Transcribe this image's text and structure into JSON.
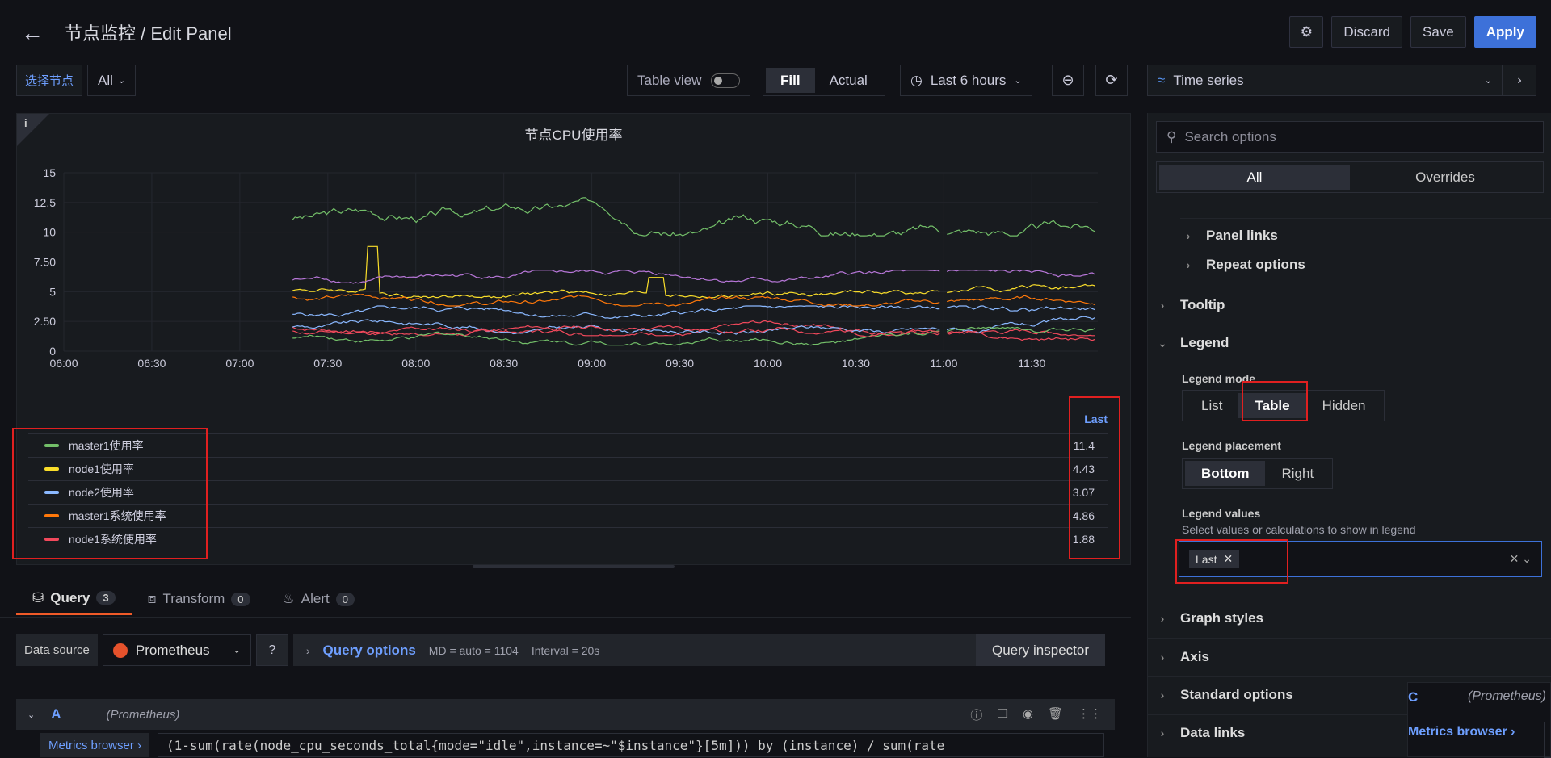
{
  "header": {
    "title": "节点监控 / Edit Panel",
    "discard": "Discard",
    "save": "Save",
    "apply": "Apply"
  },
  "vars": {
    "label": "选择节点",
    "value": "All"
  },
  "toolbar": {
    "table_view": "Table view",
    "fill": "Fill",
    "actual": "Actual",
    "time_range": "Last 6 hours"
  },
  "viz": {
    "name": "Time series"
  },
  "panel": {
    "title": "节点CPU使用率",
    "legend_header": "Last"
  },
  "chart_data": {
    "type": "line",
    "title": "节点CPU使用率",
    "x": [
      "06:00",
      "06:30",
      "07:00",
      "07:30",
      "08:00",
      "08:30",
      "09:00",
      "09:30",
      "10:00",
      "10:30",
      "11:00",
      "11:30"
    ],
    "yticks": [
      "0",
      "2.50",
      "5",
      "7.50",
      "10",
      "12.5",
      "15"
    ],
    "ylim": [
      0,
      15
    ],
    "data_start": "07:18",
    "data_end": "11:52",
    "series": [
      {
        "name": "master1使用率",
        "color": "#73bf69",
        "last": "11.4"
      },
      {
        "name": "node1使用率",
        "color": "#fade2a",
        "last": "4.43"
      },
      {
        "name": "node2使用率",
        "color": "#8ab8ff",
        "last": "3.07"
      },
      {
        "name": "master1系统使用率",
        "color": "#ff780a",
        "last": "4.86"
      },
      {
        "name": "node1系统使用率",
        "color": "#f2495c",
        "last": "1.88"
      }
    ],
    "legend": "bottom-table"
  },
  "query": {
    "tabs": [
      {
        "label": "Query",
        "count": "3"
      },
      {
        "label": "Transform",
        "count": "0"
      },
      {
        "label": "Alert",
        "count": "0"
      }
    ],
    "datasource_label": "Data source",
    "datasource": "Prometheus",
    "query_options": "Query options",
    "md": "MD = auto = 1104",
    "interval": "Interval = 20s",
    "inspector": "Query inspector",
    "ref": "A",
    "ref_source": "(Prometheus)",
    "metrics_browser": "Metrics browser ›",
    "expr": "(1-sum(rate(node_cpu_seconds_total{mode=\"idle\",instance=~\"$instance\"}[5m])) by (instance) / sum(rate"
  },
  "options": {
    "search_placeholder": "Search options",
    "tab_all": "All",
    "tab_overrides": "Overrides",
    "panel_links": "Panel links",
    "repeat_options": "Repeat options",
    "tooltip": "Tooltip",
    "legend": "Legend",
    "legend_mode_label": "Legend mode",
    "legend_modes": [
      "List",
      "Table",
      "Hidden"
    ],
    "legend_placement_label": "Legend placement",
    "legend_placements": [
      "Bottom",
      "Right"
    ],
    "legend_values_label": "Legend values",
    "legend_values_desc": "Select values or calculations to show in legend",
    "legend_values_chip": "Last",
    "graph_styles": "Graph styles",
    "axis": "Axis",
    "standard_options": "Standard options",
    "data_links": "Data links",
    "floating_ref": "C",
    "floating_src": "(Prometheus)",
    "floating_mb": "Metrics browser ›"
  }
}
